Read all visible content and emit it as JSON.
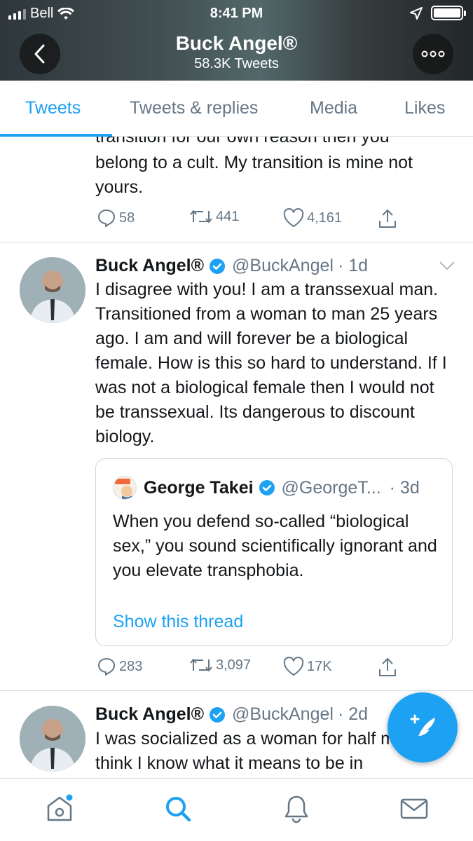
{
  "status_bar": {
    "carrier": "Bell",
    "time": "8:41 PM"
  },
  "profile": {
    "name": "Buck Angel®",
    "tweet_count": "58.3K Tweets"
  },
  "tabs": [
    {
      "label": "Tweets",
      "active": true
    },
    {
      "label": "Tweets & replies",
      "active": false
    },
    {
      "label": "Media",
      "active": false
    },
    {
      "label": "Likes",
      "active": false
    }
  ],
  "tweets": [
    {
      "partial_text_top": "transition for our own reason then you",
      "text": "belong to a cult. My transition is mine not yours.",
      "replies": "58",
      "retweets": "441",
      "likes": "4,161"
    },
    {
      "author_name": "Buck Angel®",
      "handle": "@BuckAngel",
      "time": "· 1d",
      "text": "I disagree with you! I am a transsexual man. Transitioned from a woman to man 25 years ago. I am and will forever be a biological female. How is this so hard to understand. If I was not a biological female then I would not be transsexual. Its dangerous to discount biology.",
      "quote": {
        "author_name": "George Takei",
        "handle": "@GeorgeT...",
        "time": "· 3d",
        "text": "When you defend so-called “biological sex,” you sound scientifically ignorant and you elevate transphobia.",
        "link": "Show this thread"
      },
      "replies": "283",
      "retweets": "3,097",
      "likes": "17K"
    },
    {
      "author_name": "Buck Angel®",
      "handle": "@BuckAngel",
      "time": "· 2d",
      "text": "I was socialized as a woman for half my life. I think I know what it means to be in"
    }
  ],
  "colors": {
    "accent": "#1da1f2",
    "secondary_text": "#657786",
    "divider": "#d9dee2"
  }
}
